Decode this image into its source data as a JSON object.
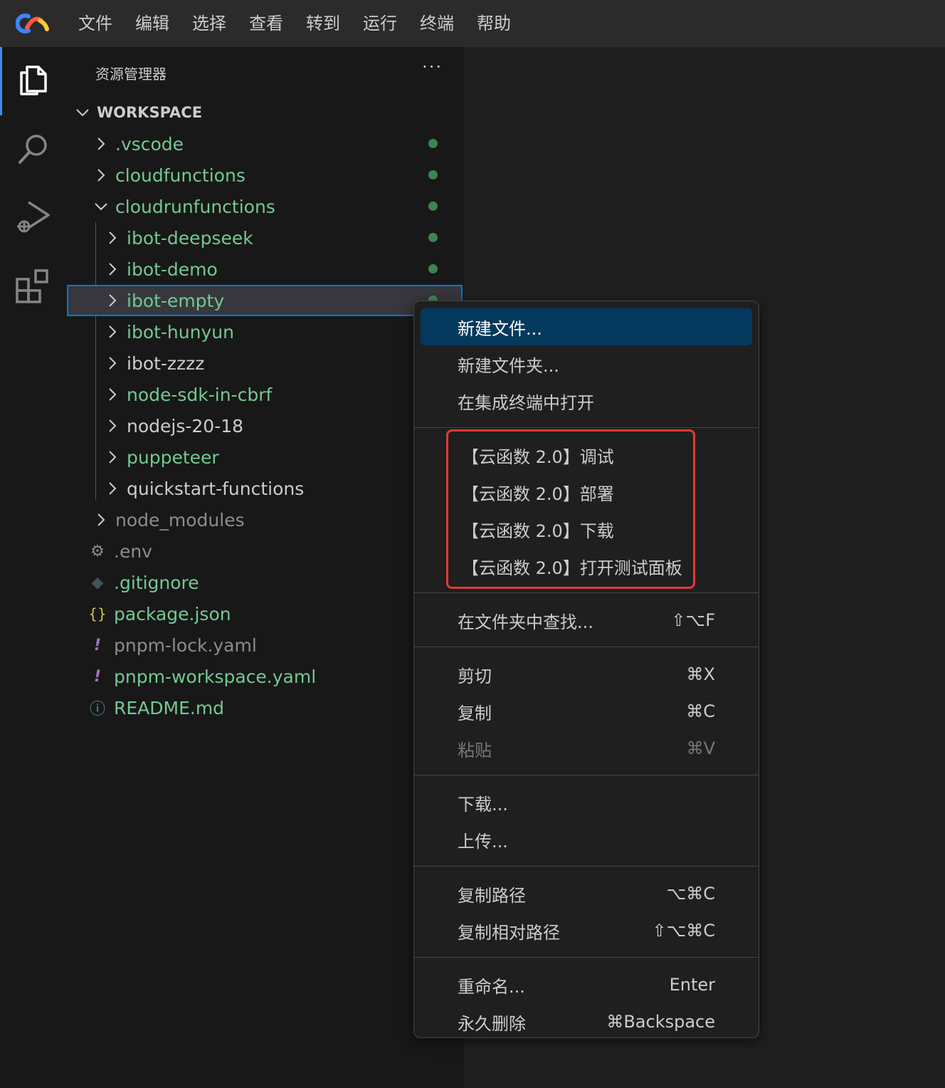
{
  "menubar": {
    "items": [
      "文件",
      "编辑",
      "选择",
      "查看",
      "转到",
      "运行",
      "终端",
      "帮助"
    ]
  },
  "activitybar": {
    "icons": [
      "explorer-icon",
      "search-icon",
      "run-debug-icon",
      "extensions-icon"
    ]
  },
  "sidebar": {
    "title": "资源管理器",
    "more": "···",
    "workspace": "WORKSPACE",
    "tree": [
      {
        "label": ".vscode",
        "type": "folder",
        "expanded": false,
        "level": 1,
        "color": "green",
        "dot": true
      },
      {
        "label": "cloudfunctions",
        "type": "folder",
        "expanded": false,
        "level": 1,
        "color": "green",
        "dot": true
      },
      {
        "label": "cloudrunfunctions",
        "type": "folder",
        "expanded": true,
        "level": 1,
        "color": "green",
        "dot": true
      },
      {
        "label": "ibot-deepseek",
        "type": "folder",
        "expanded": false,
        "level": 2,
        "color": "green",
        "dot": true
      },
      {
        "label": "ibot-demo",
        "type": "folder",
        "expanded": false,
        "level": 2,
        "color": "green",
        "dot": true
      },
      {
        "label": "ibot-empty",
        "type": "folder",
        "expanded": false,
        "level": 2,
        "color": "green",
        "dot": true,
        "selected": true
      },
      {
        "label": "ibot-hunyun",
        "type": "folder",
        "expanded": false,
        "level": 2,
        "color": "green",
        "dot": false
      },
      {
        "label": "ibot-zzzz",
        "type": "folder",
        "expanded": false,
        "level": 2,
        "color": "white",
        "dot": false
      },
      {
        "label": "node-sdk-in-cbrf",
        "type": "folder",
        "expanded": false,
        "level": 2,
        "color": "green",
        "dot": false
      },
      {
        "label": "nodejs-20-18",
        "type": "folder",
        "expanded": false,
        "level": 2,
        "color": "white",
        "dot": false
      },
      {
        "label": "puppeteer",
        "type": "folder",
        "expanded": false,
        "level": 2,
        "color": "green",
        "dot": false
      },
      {
        "label": "quickstart-functions",
        "type": "folder",
        "expanded": false,
        "level": 2,
        "color": "white",
        "dot": false
      },
      {
        "label": "node_modules",
        "type": "folder",
        "expanded": false,
        "level": 1,
        "color": "gray",
        "dot": false
      },
      {
        "label": ".env",
        "type": "file",
        "icon": "gear-icon",
        "glyph": "⚙",
        "iconColor": "#8c8c8c",
        "level": 1,
        "color": "gray"
      },
      {
        "label": ".gitignore",
        "type": "file",
        "icon": "git-icon",
        "glyph": "◆",
        "iconColor": "#41535b",
        "level": 1,
        "color": "green"
      },
      {
        "label": "package.json",
        "type": "file",
        "icon": "json-braces-icon",
        "glyph": "{}",
        "iconColor": "#cbcb41",
        "level": 1,
        "color": "green"
      },
      {
        "label": "pnpm-lock.yaml",
        "type": "file",
        "icon": "yaml-icon",
        "glyph": "!",
        "iconColor": "#a074c4",
        "level": 1,
        "color": "gray"
      },
      {
        "label": "pnpm-workspace.yaml",
        "type": "file",
        "icon": "yaml-icon",
        "glyph": "!",
        "iconColor": "#a074c4",
        "level": 1,
        "color": "green"
      },
      {
        "label": "README.md",
        "type": "file",
        "icon": "info-icon",
        "glyph": "ⓘ",
        "iconColor": "#519aba",
        "level": 1,
        "color": "green"
      }
    ]
  },
  "context_menu": {
    "items": [
      {
        "label": "新建文件...",
        "key": "",
        "highlight": true
      },
      {
        "label": "新建文件夹...",
        "key": ""
      },
      {
        "label": "在集成终端中打开",
        "key": ""
      },
      {
        "sep": true
      },
      {
        "label": "【云函数 2.0】调试",
        "key": "",
        "cloud": true
      },
      {
        "label": "【云函数 2.0】部署",
        "key": "",
        "cloud": true
      },
      {
        "label": "【云函数 2.0】下载",
        "key": "",
        "cloud": true
      },
      {
        "label": "【云函数 2.0】打开测试面板",
        "key": "",
        "cloud": true
      },
      {
        "sep": true
      },
      {
        "label": "在文件夹中查找...",
        "key": "⇧⌥F"
      },
      {
        "sep": true
      },
      {
        "label": "剪切",
        "key": "⌘X"
      },
      {
        "label": "复制",
        "key": "⌘C"
      },
      {
        "label": "粘贴",
        "key": "⌘V",
        "disabled": true
      },
      {
        "sep": true
      },
      {
        "label": "下载...",
        "key": ""
      },
      {
        "label": "上传...",
        "key": ""
      },
      {
        "sep": true
      },
      {
        "label": "复制路径",
        "key": "⌥⌘C"
      },
      {
        "label": "复制相对路径",
        "key": "⇧⌥⌘C"
      },
      {
        "sep": true
      },
      {
        "label": "重命名...",
        "key": "Enter"
      },
      {
        "label": "永久删除",
        "key": "⌘Backspace"
      }
    ]
  },
  "colors": {
    "accent": "#0078d4",
    "highlight": "#04395e",
    "git_added": "#73c991",
    "annotation_box": "#e53935"
  }
}
